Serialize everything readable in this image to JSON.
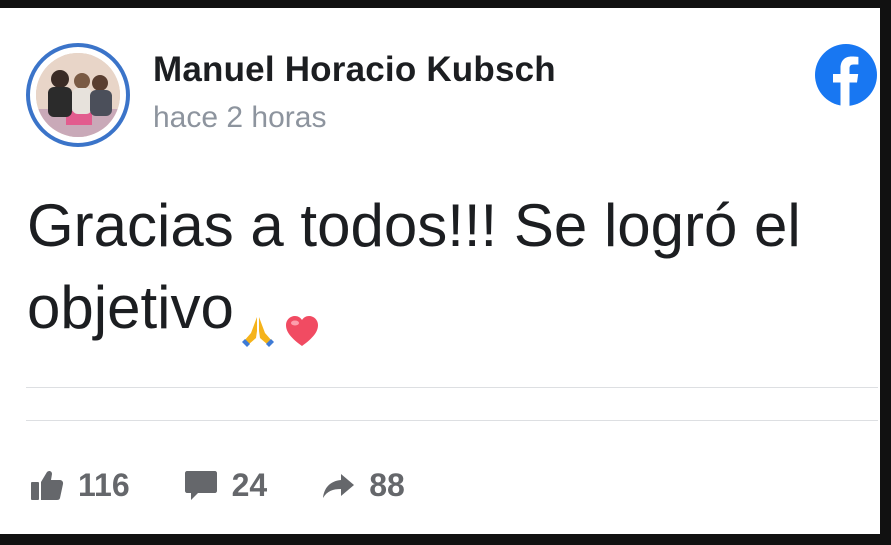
{
  "post": {
    "author": "Manuel Horacio Kubsch",
    "time": "hace 2 horas",
    "text": "Gracias a todos!!! Se logró el objetivo",
    "emojis": [
      "praying-hands-icon",
      "heart-icon"
    ]
  },
  "stats": {
    "likes": "116",
    "comments": "24",
    "shares": "88"
  },
  "colors": {
    "avatar_ring": "#3b74c9",
    "facebook_blue": "#1877f2",
    "muted_text": "#8d949e",
    "stats_text": "#65676b"
  }
}
